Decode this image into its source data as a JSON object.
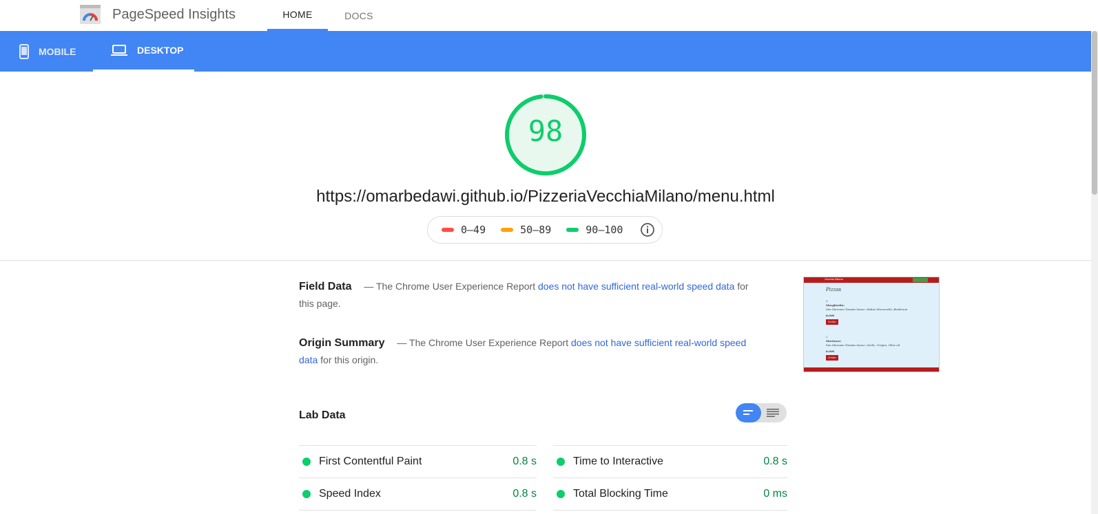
{
  "header": {
    "app_title": "PageSpeed Insights",
    "tabs": [
      "HOME",
      "DOCS"
    ],
    "active_tab": "HOME"
  },
  "device_tabs": {
    "mobile": "MOBILE",
    "desktop": "DESKTOP",
    "active": "DESKTOP"
  },
  "score": {
    "value": "98",
    "fraction": 0.98,
    "color": "#0cce6b"
  },
  "url": "https://omarbedawi.github.io/PizzeriaVecchiaMilano/menu.html",
  "legend": [
    {
      "label": "0–49",
      "color": "#ff4e42"
    },
    {
      "label": "50–89",
      "color": "#ffa400"
    },
    {
      "label": "90–100",
      "color": "#0cce6b"
    }
  ],
  "field_data": {
    "title": "Field Data",
    "prefix": "— The Chrome User Experience Report",
    "link": "does not have sufficient real-world speed data",
    "suffix": "for this page."
  },
  "origin_summary": {
    "title": "Origin Summary",
    "prefix": "— The Chrome User Experience Report",
    "link": "does not have sufficient real-world speed data",
    "suffix": "for this origin."
  },
  "lab_data": {
    "title": "Lab Data",
    "metrics": [
      {
        "name": "First Contentful Paint",
        "value": "0.8 s"
      },
      {
        "name": "Time to Interactive",
        "value": "0.8 s"
      },
      {
        "name": "Speed Index",
        "value": "0.8 s"
      },
      {
        "name": "Total Blocking Time",
        "value": "0 ms"
      }
    ]
  },
  "thumbnail": {
    "site_name": "Vecchia Milano",
    "heading": "Pizzas",
    "items": [
      {
        "num": "1",
        "name": "Margherita:",
        "desc": "San Marzano Tomato Sauce, Italian Mozzarella, Basilicum",
        "price": "8.00€",
        "button": "Order"
      },
      {
        "num": "2",
        "name": "Marinara:",
        "desc": "San Marzano Tomato Sauce, Garlic, Origan, Olive oil",
        "price": "8.00€",
        "button": "Order"
      }
    ]
  }
}
